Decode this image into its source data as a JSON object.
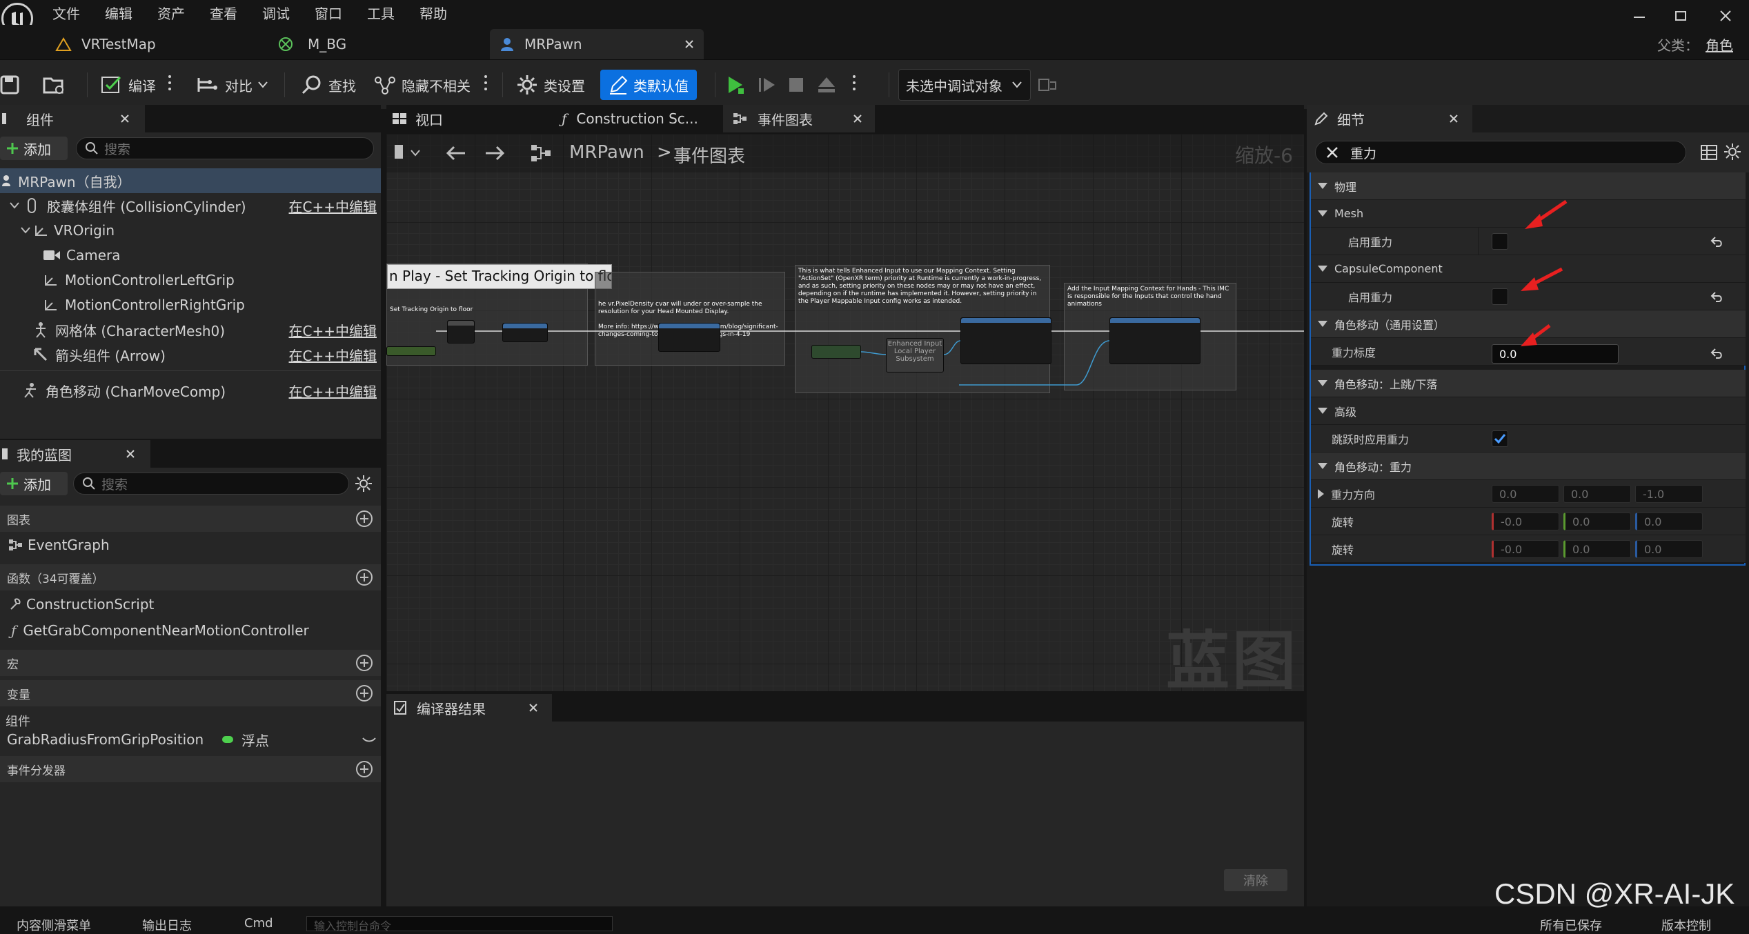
{
  "menu": [
    "文件",
    "编辑",
    "资产",
    "查看",
    "调试",
    "窗口",
    "工具",
    "帮助"
  ],
  "tabs": [
    {
      "label": "VRTestMap"
    },
    {
      "label": "M_BG"
    },
    {
      "label": "MRPawn"
    }
  ],
  "parent_class": {
    "label": "父类：",
    "value": "角色"
  },
  "toolbar": {
    "compile": "编译",
    "diff": "对比",
    "find": "查找",
    "hide_unrelated": "隐藏不相关",
    "class_settings": "类设置",
    "class_defaults": "类默认值",
    "debug_target": "未选中调试对象"
  },
  "components": {
    "title": "组件",
    "add": "添加",
    "search_placeholder": "搜索",
    "root": "MRPawn（自我）",
    "items": [
      {
        "label": "胶囊体组件 (CollisionCylinder)",
        "edit": "在C++中编辑"
      },
      {
        "label": "VROrigin"
      },
      {
        "label": "Camera"
      },
      {
        "label": "MotionControllerLeftGrip"
      },
      {
        "label": "MotionControllerRightGrip"
      },
      {
        "label": "网格体 (CharacterMesh0)",
        "edit": "在C++中编辑"
      },
      {
        "label": "箭头组件 (Arrow)",
        "edit": "在C++中编辑"
      },
      {
        "label": "角色移动 (CharMoveComp)",
        "edit": "在C++中编辑"
      }
    ]
  },
  "my_blueprint": {
    "title": "我的蓝图",
    "add": "添加",
    "search_placeholder": "搜索",
    "graphs": "图表",
    "event_graph": "EventGraph",
    "functions": "函数（34可覆盖）",
    "construction_script": "ConstructionScript",
    "function_1": "GetGrabComponentNearMotionController",
    "macros": "宏",
    "variables": "变量",
    "components_group": "组件",
    "variable_name": "GrabRadiusFromGripPosition",
    "variable_type": "浮点",
    "event_dispatchers": "事件分发器"
  },
  "graph_tabs": [
    {
      "label": "视口"
    },
    {
      "label": "Construction Sc..."
    },
    {
      "label": "事件图表"
    }
  ],
  "graph": {
    "breadcrumb_root": "MRPawn",
    "breadcrumb_sep": ">",
    "breadcrumb_leaf": "事件图表",
    "zoom": "缩放-6",
    "watermark": "蓝图",
    "comment1_title": "n Play - Set Tracking Origin to floo",
    "comment1_sub": "Set Tracking Origin to floor",
    "comment2": "he vr.PixelDensity cvar will under or over-sample the resolution for your Head Mounted Display.\n\nMore info: https://www.unrealengine.com/blog/significant-changes-coming-to-vr-resolution-settings-in-4-19",
    "comment3": "This is what tells Enhanced Input to use our Mapping Context. Setting \"ActionSet\" (OpenXR term) priority at Runtime is currently a work-in-progress, and as such, setting priority on these nodes may or may not have an effect, depending on if the runtime has implemented it. However, setting priority in the Player Mappable Input config works as intended.",
    "comment4": "Add the Input Mapping Context for Hands - This IMC is responsible for the Inputs that control the hand animations",
    "subsystem_node": "Enhanced Input Local Player Subsystem"
  },
  "compiler": {
    "title": "编译器结果",
    "clear": "清除"
  },
  "details": {
    "title": "细节",
    "search_value": "重力",
    "cat_physics": "物理",
    "mesh": "Mesh",
    "enable_gravity_1": "启用重力",
    "enable_gravity_1_checked": false,
    "capsule": "CapsuleComponent",
    "enable_gravity_2": "启用重力",
    "enable_gravity_2_checked": false,
    "cat_movement_general": "角色移动（通用设置）",
    "gravity_scale": "重力标度",
    "gravity_scale_value": "0.0",
    "cat_jump": "角色移动：上跳/下落",
    "advanced": "高级",
    "apply_gravity_jump": "跳跃时应用重力",
    "apply_gravity_jump_checked": true,
    "cat_gravity": "角色移动：重力",
    "gravity_direction": "重力方向",
    "gravity_direction_values": [
      "0.0",
      "0.0",
      "-1.0"
    ],
    "rotation_1": "旋转",
    "rotation_1_values": [
      "-0.0",
      "0.0",
      "0.0"
    ],
    "rotation_2": "旋转",
    "rotation_2_values": [
      "-0.0",
      "0.0",
      "0.0"
    ]
  },
  "bottom": {
    "content_drawer": "内容侧滑菜单",
    "output_log": "输出日志",
    "cmd": "Cmd",
    "console_placeholder": "输入控制台命令",
    "saved": "所有已保存",
    "source_control": "版本控制"
  },
  "watermark_text": "CSDN @XR-AI-JK",
  "colors": {
    "accent": "#0b70e0",
    "play": "#3fbf3f",
    "arrow": "#e82020",
    "selected_row": "#37485c"
  }
}
